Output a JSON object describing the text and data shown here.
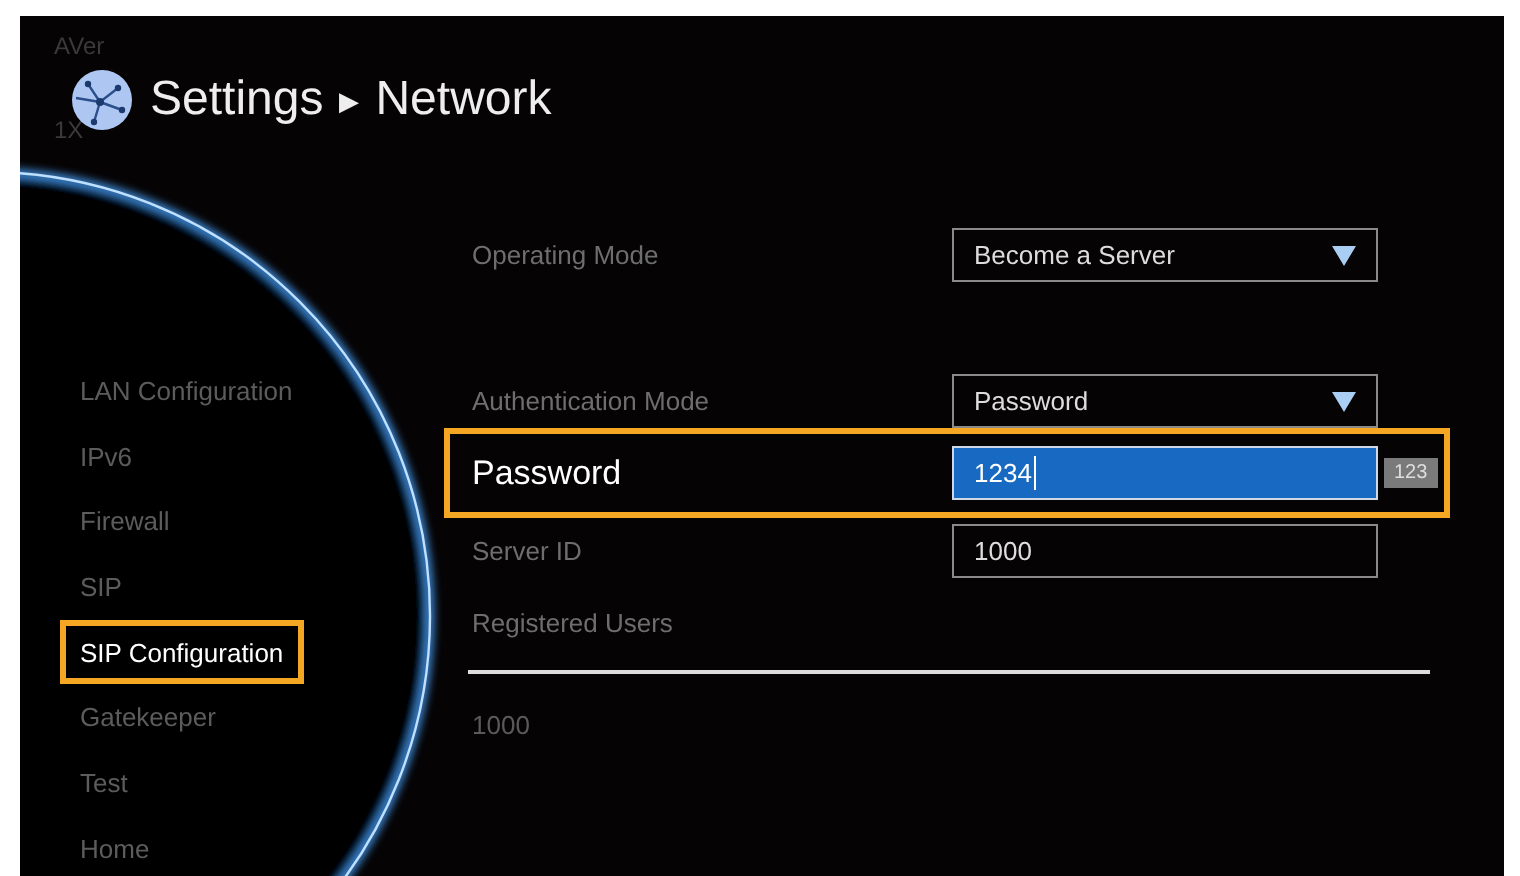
{
  "header": {
    "brand": "AVer",
    "zoom": "1X",
    "title": "Settings",
    "separator": "▶",
    "subtitle": "Network"
  },
  "sidebar": {
    "items": [
      {
        "label": "LAN Configuration",
        "selected": false
      },
      {
        "label": "IPv6",
        "selected": false
      },
      {
        "label": "Firewall",
        "selected": false
      },
      {
        "label": "SIP",
        "selected": false
      },
      {
        "label": "SIP Configuration",
        "selected": true
      },
      {
        "label": "Gatekeeper",
        "selected": false
      },
      {
        "label": "Test",
        "selected": false
      },
      {
        "label": "Home",
        "selected": false
      }
    ]
  },
  "fields": [
    {
      "kind": "dropdown",
      "label": "Operating Mode",
      "value": "Become a Server",
      "focused": false
    },
    {
      "kind": "dropdown",
      "label": "Authentication Mode",
      "value": "Password",
      "focused": false
    },
    {
      "kind": "input",
      "label": "Password",
      "value": "1234",
      "focused": true,
      "input_mode": "123"
    },
    {
      "kind": "input",
      "label": "Server ID",
      "value": "1000",
      "focused": false
    }
  ],
  "registered_users": {
    "heading": "Registered Users",
    "users": [
      "1000"
    ]
  }
}
